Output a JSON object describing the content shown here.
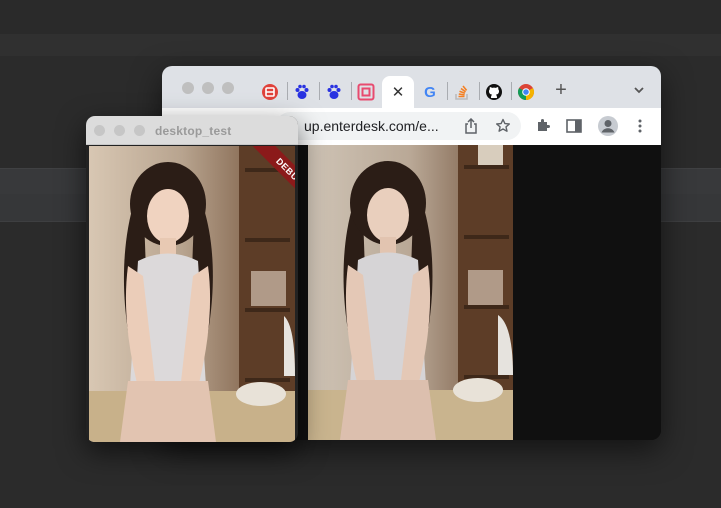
{
  "desktop": {
    "background": "#2b2b2b"
  },
  "chrome": {
    "tabs": [
      {
        "icon": "red-circle-logo-icon",
        "glyph": "",
        "color": "#e0413a"
      },
      {
        "icon": "baidu-paw-icon",
        "glyph": "🐾",
        "color": "#2932e1"
      },
      {
        "icon": "baidu-paw-icon",
        "glyph": "🐾",
        "color": "#2932e1"
      },
      {
        "icon": "pink-square-logo-icon",
        "glyph": "",
        "color": "#e84a6f"
      },
      {
        "icon": "close-icon",
        "glyph": "✕",
        "color": "#333333"
      },
      {
        "icon": "google-icon",
        "glyph": "G",
        "color": "#4285f4"
      },
      {
        "icon": "stackoverflow-icon",
        "glyph": "",
        "color": "#f48024"
      },
      {
        "icon": "github-icon",
        "glyph": "",
        "color": "#111111"
      },
      {
        "icon": "chrome-icon",
        "glyph": "",
        "color": "#34a853"
      }
    ],
    "new_tab": "+",
    "tab_menu": "⌄",
    "url": "up.enterdesk.com/e..."
  },
  "app": {
    "title": "desktop_test",
    "debug_banner": "DEBUG"
  }
}
